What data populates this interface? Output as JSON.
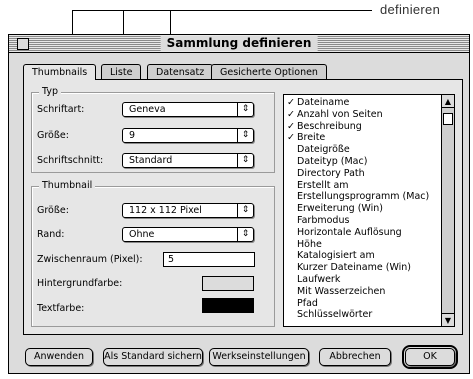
{
  "callout": {
    "text": "definieren"
  },
  "window": {
    "title": "Sammlung definieren"
  },
  "tabs": [
    {
      "label": "Thumbnails",
      "active": true
    },
    {
      "label": "Liste",
      "active": false
    },
    {
      "label": "Datensatz",
      "active": false
    },
    {
      "label": "Gesicherte Optionen",
      "active": false
    }
  ],
  "typ": {
    "title": "Typ",
    "schriftart_label": "Schriftart:",
    "schriftart_value": "Geneva",
    "groesse_label": "Größe:",
    "groesse_value": "9",
    "schriftschnitt_label": "Schriftschnitt:",
    "schriftschnitt_value": "Standard"
  },
  "thumbnail": {
    "title": "Thumbnail",
    "groesse_label": "Größe:",
    "groesse_value": "112 x 112 Pixel",
    "rand_label": "Rand:",
    "rand_value": "Ohne",
    "zwischenraum_label": "Zwischenraum (Pixel):",
    "zwischenraum_value": "5",
    "hintergrund_label": "Hintergrundfarbe:",
    "textfarbe_label": "Textfarbe:",
    "hintergrund_color": "#dcdcdc",
    "textfarbe_color": "#000000"
  },
  "fields": [
    {
      "label": "Dateiname",
      "checked": true
    },
    {
      "label": "Anzahl von Seiten",
      "checked": true
    },
    {
      "label": "Beschreibung",
      "checked": true
    },
    {
      "label": "Breite",
      "checked": true
    },
    {
      "label": "Dateigröße",
      "checked": false
    },
    {
      "label": "Dateityp (Mac)",
      "checked": false
    },
    {
      "label": "Directory Path",
      "checked": false
    },
    {
      "label": "Erstellt am",
      "checked": false
    },
    {
      "label": "Erstellungsprogramm (Mac)",
      "checked": false
    },
    {
      "label": "Erweiterung (Win)",
      "checked": false
    },
    {
      "label": "Farbmodus",
      "checked": false
    },
    {
      "label": "Horizontale Auflösung",
      "checked": false
    },
    {
      "label": "Höhe",
      "checked": false
    },
    {
      "label": "Katalogisiert am",
      "checked": false
    },
    {
      "label": "Kurzer Dateiname (Win)",
      "checked": false
    },
    {
      "label": "Laufwerk",
      "checked": false
    },
    {
      "label": "Mit Wasserzeichen",
      "checked": false
    },
    {
      "label": "Pfad",
      "checked": false
    },
    {
      "label": "Schlüsselwörter",
      "checked": false
    }
  ],
  "check_glyph": "✓",
  "buttons": {
    "anwenden": "Anwenden",
    "standard": "Als Standard sichern",
    "werkseinstellungen": "Werkseinstellungen",
    "abbrechen": "Abbrechen",
    "ok": "OK"
  },
  "icons": {
    "popup_arrow": "updown-arrows-icon",
    "scroll_up": "up-arrow-icon",
    "scroll_down": "down-arrow-icon",
    "close": "close-box-icon"
  }
}
